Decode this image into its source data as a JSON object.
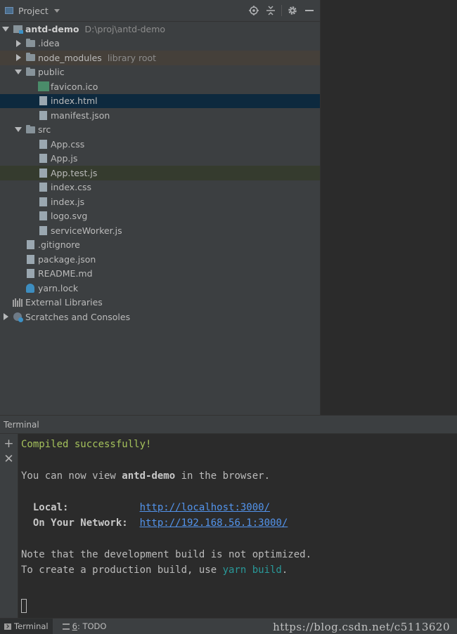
{
  "project_panel": {
    "title": "Project",
    "tree": [
      {
        "label": "antd-demo",
        "sub": "D:\\proj\\antd-demo",
        "indent": 0,
        "arrow": "down",
        "icon": "module",
        "bold": true
      },
      {
        "label": ".idea",
        "indent": 1,
        "arrow": "right",
        "icon": "folder"
      },
      {
        "label": "node_modules",
        "sub": "library root",
        "indent": 1,
        "arrow": "right",
        "icon": "folder",
        "hl": "lib"
      },
      {
        "label": "public",
        "indent": 1,
        "arrow": "down",
        "icon": "folder"
      },
      {
        "label": "favicon.ico",
        "indent": 2,
        "icon": "file",
        "tag": "ico"
      },
      {
        "label": "index.html",
        "indent": 2,
        "icon": "file",
        "tag": "html",
        "hl": "selected"
      },
      {
        "label": "manifest.json",
        "indent": 2,
        "icon": "file",
        "tag": "json"
      },
      {
        "label": "src",
        "indent": 1,
        "arrow": "down",
        "icon": "folder"
      },
      {
        "label": "App.css",
        "indent": 2,
        "icon": "file",
        "tag": "css"
      },
      {
        "label": "App.js",
        "indent": 2,
        "icon": "file",
        "tag": "js"
      },
      {
        "label": "App.test.js",
        "indent": 2,
        "icon": "file",
        "tag": "js",
        "hl": "test"
      },
      {
        "label": "index.css",
        "indent": 2,
        "icon": "file",
        "tag": "css"
      },
      {
        "label": "index.js",
        "indent": 2,
        "icon": "file",
        "tag": "js"
      },
      {
        "label": "logo.svg",
        "indent": 2,
        "icon": "file",
        "tag": "svg"
      },
      {
        "label": "serviceWorker.js",
        "indent": 2,
        "icon": "file",
        "tag": "js"
      },
      {
        "label": ".gitignore",
        "indent": 1,
        "icon": "file",
        "tag": ""
      },
      {
        "label": "package.json",
        "indent": 1,
        "icon": "file",
        "tag": "json"
      },
      {
        "label": "README.md",
        "indent": 1,
        "icon": "file",
        "tag": "md"
      },
      {
        "label": "yarn.lock",
        "indent": 1,
        "icon": "yarn"
      },
      {
        "label": "External Libraries",
        "indent": 0,
        "icon": "libs"
      },
      {
        "label": "Scratches and Consoles",
        "indent": 0,
        "arrow": "right",
        "icon": "scratch"
      }
    ]
  },
  "terminal": {
    "title": "Terminal",
    "compiled": "Compiled successfully!",
    "view_pre": "You can now view ",
    "app_name": "antd-demo",
    "view_post": " in the browser.",
    "local_label": "  Local:            ",
    "local_url": "http://localhost:3000/",
    "network_label": "  On Your Network:  ",
    "network_url": "http://192.168.56.1:3000/",
    "note": "Note that the development build is not optimized.",
    "prod_pre": "To create a production build, use ",
    "prod_cmd": "yarn build",
    "prod_post": "."
  },
  "status_bar": {
    "terminal_tab": "Terminal",
    "todo_num": "6",
    "todo_label": ": TODO",
    "watermark": "https://blog.csdn.net/c5113620"
  },
  "colors": {
    "success": "#a5c25c",
    "link": "#5394ec",
    "command": "#299999",
    "selection": "#0d293e"
  }
}
